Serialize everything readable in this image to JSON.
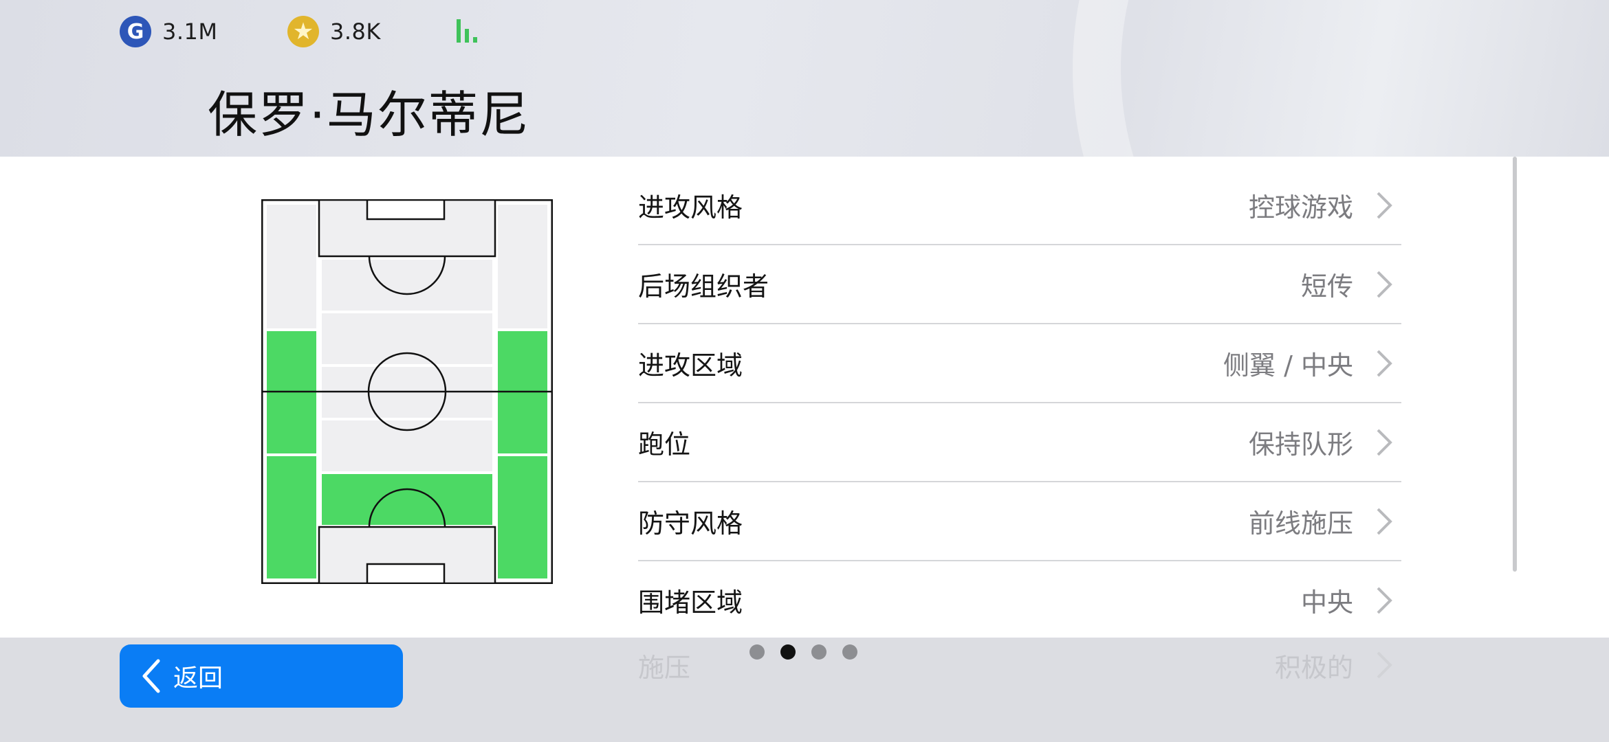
{
  "currency": {
    "gp": {
      "icon": "g-coin-icon",
      "letter": "G",
      "value": "3.1M"
    },
    "coins": {
      "icon": "star-coin-icon",
      "value": "3.8K"
    },
    "signal_icon": "signal-strength-icon"
  },
  "player": {
    "name": "保罗·马尔蒂尼"
  },
  "pitch": {
    "highlight_color": "#4cd964",
    "zones_highlighted": [
      "left-flank-middle",
      "left-flank-lower",
      "right-flank-middle",
      "right-flank-lower",
      "central-defensive"
    ]
  },
  "settings": {
    "rows": [
      {
        "label": "进攻风格",
        "value": "控球游戏"
      },
      {
        "label": "后场组织者",
        "value": "短传"
      },
      {
        "label": "进攻区域",
        "value": "侧翼 / 中央"
      },
      {
        "label": "跑位",
        "value": "保持队形"
      },
      {
        "label": "防守风格",
        "value": "前线施压"
      },
      {
        "label": "围堵区域",
        "value": "中央"
      }
    ],
    "faded_row": {
      "label": "施压",
      "value": "积极的"
    }
  },
  "back_button": {
    "label": "返回",
    "icon": "chevron-left-icon"
  },
  "pagination": {
    "pages": 4,
    "active": 2
  },
  "colors": {
    "accent": "#0a7df5",
    "pitch_green": "#4cd964"
  }
}
